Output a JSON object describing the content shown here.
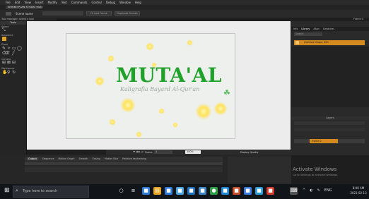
{
  "menu": [
    "File",
    "Edit",
    "View",
    "Insert",
    "Modify",
    "Text",
    "Commands",
    "Control",
    "Debug",
    "Window",
    "Help"
  ],
  "document": {
    "tab_label": "ISHUBO PLAN STUDIO mutaal"
  },
  "toolbar": {
    "scene_label": "Scene name",
    "btn1": "Fit Last Frame",
    "btn2": "Duplicate Frames"
  },
  "properties_label": "Tool manager: select a tool",
  "right_top_label": "Frame 0",
  "tools": {
    "header": "Tools",
    "sections": [
      "Select",
      "Subselect",
      "Draw",
      "Camera",
      "Workspace"
    ]
  },
  "stage": {
    "title": "MUTA'AL",
    "subtitle": "Kaligrafia Bayard Al-Qur'an",
    "accent_color": "#1fa12a"
  },
  "right_panel": {
    "tabs": [
      "Info",
      "Library",
      "Align",
      "Swatches"
    ],
    "active_tab": "Library",
    "search_placeholder": "Search",
    "item_label": "Untitled Shape 000",
    "layers_header": "Layers",
    "layer_name": "Frame 0"
  },
  "stage_bar": {
    "frame_label": "Frame",
    "frame_value": "1",
    "zoom_value": "100%",
    "quality_label": "Display Quality"
  },
  "timeline": {
    "tabs": [
      "Output",
      "Sequence",
      "Motion Graph",
      "Smooth",
      "Easing",
      "Motion Blur",
      "Relative keyframing"
    ],
    "active_tab": "Output"
  },
  "activation": {
    "title": "Activate Windows",
    "subtitle": "Go to Settings to activate Windows."
  },
  "taskbar": {
    "search_text": "Type here to search",
    "time": "8:00 AM",
    "date": "2021-02-13"
  },
  "colors": {
    "orange": "#d58a1d",
    "green": "#1fa12a"
  }
}
